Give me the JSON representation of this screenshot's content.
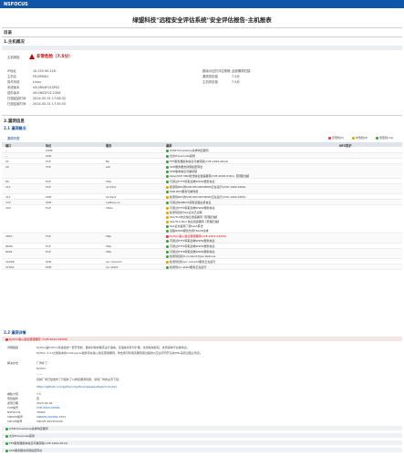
{
  "brand": {
    "logo": "NSFOCUS",
    "bar_color": "#0e56a8"
  },
  "report_title": "绿盟科技\"远程安全评估系统\"安全评估报告-主机报表",
  "toc_label": "目录",
  "section1": {
    "title": "1.主机概况",
    "band": "",
    "risk_label": "主机风险",
    "risk_value": "非常危险（7.5分）",
    "left": [
      {
        "k": "IP地址",
        "v": "10.255.90.218"
      },
      {
        "k": "主机名",
        "v": "FR-ERMA1"
      },
      {
        "k": "操作系统",
        "v": "Linux"
      },
      {
        "k": "系统版本",
        "v": "V6.0R04F01SP02"
      },
      {
        "k": "插件版本",
        "v": "V6.0R02F01.2306"
      },
      {
        "k": "扫描起始时间",
        "v": "2024-05-31 17:08:32"
      },
      {
        "k": "扫描结束时间",
        "v": "2024-05-31 17:35:53"
      }
    ],
    "right": [
      {
        "k": "模版对应的评估策略",
        "v": "全部漏洞扫描"
      },
      {
        "k": "漏洞风险值",
        "v": "7.5分"
      },
      {
        "k": "主机风险值",
        "v": "7.5分"
      }
    ]
  },
  "section2": {
    "title": "2.漏洞信息",
    "sub1": "2.1 漏洞概况",
    "list_label": "漏洞列表",
    "legend": {
      "high": "高危险(5)",
      "mid": "中危险(8)",
      "low": "低危险(14)"
    },
    "headers": [
      "端口",
      "协议",
      "服务",
      "漏洞",
      "NFC防护"
    ],
    "rows": [
      {
        "port": "--",
        "proto": "ICMP",
        "svc": "",
        "vulns": [
          {
            "l": "l",
            "t": "ICMP timestamp请求响应漏洞"
          }
        ]
      },
      {
        "port": "--",
        "proto": "UDP",
        "svc": "",
        "vulns": [
          {
            "l": "l",
            "t": "允许Traceroute探测"
          }
        ]
      },
      {
        "port": "21",
        "proto": "TCP",
        "svc": "ftp",
        "vulns": [
          {
            "l": "l",
            "t": "FTP服务器版本信息可被获取(CVE-1999-0614)"
          }
        ]
      },
      {
        "port": "22",
        "proto": "TCP",
        "svc": "ssh",
        "vulns": [
          {
            "l": "l",
            "t": "SSH服务器支持弱加密算法"
          },
          {
            "l": "l",
            "t": "SSH版本信息可被获取"
          },
          {
            "l": "l",
            "t": "OpenSSH CBC模式信息泄露漏洞(CVE-2008-5161)【原理扫描】"
          }
        ]
      },
      {
        "port": "80",
        "proto": "TCP",
        "svc": "http",
        "vulns": [
          {
            "l": "l",
            "t": "可通过HTTP获取远端WWW服务信息"
          }
        ]
      },
      {
        "port": "111",
        "proto": "TCP",
        "svc": "rpcbind",
        "vulns": [
          {
            "l": "m",
            "t": "检测到RPC的SUN RPC/RPCBIND正在运行(CVE-1999-0632)"
          },
          {
            "l": "l",
            "t": "SUN RPC服务可被利用"
          }
        ]
      },
      {
        "port": "111",
        "proto": "UDP",
        "svc": "rpcbind",
        "vulns": [
          {
            "l": "m",
            "t": "检测到RPC的SUN RPC/RPCBIND正在运行(CVE-1999-0632)"
          }
        ]
      },
      {
        "port": "137",
        "proto": "UDP",
        "svc": "netbios-ns",
        "vulns": [
          {
            "l": "l",
            "t": "可通过NetBIOS获取远程主机信息"
          }
        ]
      },
      {
        "port": "443",
        "proto": "TCP",
        "svc": "https",
        "vulns": [
          {
            "l": "m",
            "t": "可通过HTTP获取远端WWW服务信息"
          },
          {
            "l": "m",
            "t": "检测到目标SSL证书已过期"
          },
          {
            "l": "m",
            "t": "SSL/TLS协议信息泄露漏洞【原理扫描】"
          },
          {
            "l": "m",
            "t": "SSL/TLS RC4 信息泄露漏洞【原理扫描】"
          },
          {
            "l": "l",
            "t": "SSL证书使用了弱hash算法"
          },
          {
            "l": "l",
            "t": "远程WWW服务支持TRACE请求"
          }
        ]
      },
      {
        "port": "1857",
        "proto": "TCP",
        "svc": "http",
        "vulns": [
          {
            "l": "h",
            "t": "Python输入验证错误漏洞(CVE-2023-24329)"
          },
          {
            "l": "l",
            "t": "可通过HTTP获取远端WWW服务信息"
          }
        ]
      },
      {
        "port": "8000",
        "proto": "TCP",
        "svc": "http",
        "vulns": [
          {
            "l": "l",
            "t": "可通过HTTP获取远端WWW服务信息"
          }
        ]
      },
      {
        "port": "9001",
        "proto": "TCP",
        "svc": "http",
        "vulns": [
          {
            "l": "l",
            "t": "可通过HTTP获取远端WWW服务信息"
          },
          {
            "l": "l",
            "t": "检测到目标X-Content-Type-Options"
          }
        ]
      },
      {
        "port": "20048",
        "proto": "UDP",
        "svc": "rpc.mountd",
        "vulns": [
          {
            "l": "m",
            "t": "检测到目标rpc.mountd服务正在运行"
          }
        ]
      },
      {
        "port": "37942",
        "proto": "UDP",
        "svc": "rpc.statd",
        "vulns": [
          {
            "l": "l",
            "t": "检测到rpc.statd服务正在运行"
          }
        ]
      }
    ],
    "sub2": "2.2 漏洞详情",
    "detail": {
      "title": "Python输入验证错误漏洞（CVE-2023-24329）",
      "label_desc": "详细描述",
      "desc1": "Python是Python基金会的一套开源的、面向对象的程序设计语言。该语言具有可扩展、支持模块和包、支持多种平台等特点。",
      "desc2": "Python 3.11之前版本的urllib.parse组件存在输入验证错误漏洞，攻击者可利用该漏洞通过提供以空白字符开头的URL来绕过阻止列表。",
      "label_fix": "解决办法",
      "fix1": "厂商补丁：",
      "fix2": "Python",
      "fix3": "------",
      "fix4": "目前厂商已经发布了升级补丁以修复漏洞问题，请到厂商的主页下载：",
      "fix_url": "https://github.com/python/cpython/releases/tag/v3.12.0a3",
      "fields": [
        {
          "k": "威胁分值",
          "v": "7.5"
        },
        {
          "k": "危险插件",
          "v": "否"
        },
        {
          "k": "发现日期",
          "v": "2023-02-09"
        },
        {
          "k": "CVE编号",
          "v": "CVE-2023-24329"
        },
        {
          "k": "NSFOCUS",
          "v": "78440"
        },
        {
          "k": "CNNVD编号",
          "v": "CNNVD-202302-1553"
        },
        {
          "k": "CNCVE编号",
          "v": "CNCVE-202324329"
        }
      ]
    },
    "collapsed": [
      {
        "l": "l",
        "t": "ICMP timestamp请求响应漏洞"
      },
      {
        "l": "l",
        "t": "允许Traceroute探测"
      },
      {
        "l": "l",
        "t": "FTP服务器版本信息可被获取(CVE-1999-0614)"
      },
      {
        "l": "l",
        "t": "SSH服务器支持弱加密算法"
      }
    ]
  }
}
